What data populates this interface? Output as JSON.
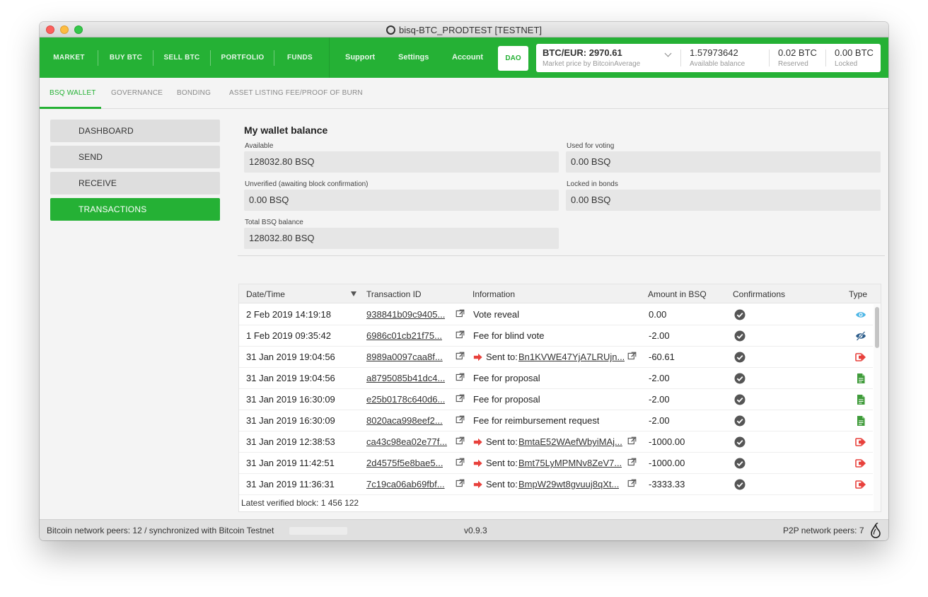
{
  "window": {
    "title": "bisq-BTC_PRODTEST [TESTNET]"
  },
  "topnav": {
    "left": [
      "MARKET",
      "BUY BTC",
      "SELL BTC",
      "PORTFOLIO",
      "FUNDS"
    ],
    "right": [
      "Support",
      "Settings",
      "Account"
    ],
    "dao": "DAO"
  },
  "balances": {
    "price_value": "BTC/EUR: 2970.61",
    "price_label": "Market price by BitcoinAverage",
    "available_value": "1.57973642",
    "available_label": "Available balance",
    "reserved_value": "0.02 BTC",
    "reserved_label": "Reserved",
    "locked_value": "0.00 BTC",
    "locked_label": "Locked"
  },
  "subtabs": [
    "BSQ WALLET",
    "GOVERNANCE",
    "BONDING",
    "ASSET LISTING FEE/PROOF OF BURN"
  ],
  "sidemenu": [
    "DASHBOARD",
    "SEND",
    "RECEIVE",
    "TRANSACTIONS"
  ],
  "wallet": {
    "title": "My wallet balance",
    "available_label": "Available",
    "available_value": "128032.80 BSQ",
    "voting_label": "Used for voting",
    "voting_value": "0.00 BSQ",
    "unverified_label": "Unverified (awaiting block confirmation)",
    "unverified_value": "0.00 BSQ",
    "bonds_label": "Locked in bonds",
    "bonds_value": "0.00 BSQ",
    "total_label": "Total BSQ balance",
    "total_value": "128032.80 BSQ"
  },
  "table": {
    "headers": [
      "Date/Time",
      "Transaction ID",
      "Information",
      "Amount in BSQ",
      "Confirmations",
      "Type"
    ],
    "rows": [
      {
        "date": "2 Feb 2019 14:19:18",
        "txid": "938841b09c9405...",
        "info": "Vote reveal",
        "sent_to": "",
        "amount": "0.00",
        "type": "eye-icon"
      },
      {
        "date": "1 Feb 2019 09:35:42",
        "txid": "6986c01cb21f75...",
        "info": "Fee for blind vote",
        "sent_to": "",
        "amount": "-2.00",
        "type": "eye-slash-icon"
      },
      {
        "date": "31 Jan 2019 19:04:56",
        "txid": "8989a0097caa8f...",
        "info": "Sent to:",
        "sent_to": "Bn1KVWE47YjA7LRUjn...",
        "amount": "-60.61",
        "type": "sent-icon"
      },
      {
        "date": "31 Jan 2019 19:04:56",
        "txid": "a8795085b41dc4...",
        "info": "Fee for proposal",
        "sent_to": "",
        "amount": "-2.00",
        "type": "document-icon"
      },
      {
        "date": "31 Jan 2019 16:30:09",
        "txid": "e25b0178c640d6...",
        "info": "Fee for proposal",
        "sent_to": "",
        "amount": "-2.00",
        "type": "document-icon"
      },
      {
        "date": "31 Jan 2019 16:30:09",
        "txid": "8020aca998eef2...",
        "info": "Fee for reimbursement request",
        "sent_to": "",
        "amount": "-2.00",
        "type": "document-icon"
      },
      {
        "date": "31 Jan 2019 12:38:53",
        "txid": "ca43c98ea02e77f...",
        "info": "Sent to:",
        "sent_to": "BmtaE52WAefWbyiMAj...",
        "amount": "-1000.00",
        "type": "sent-icon"
      },
      {
        "date": "31 Jan 2019 11:42:51",
        "txid": "2d4575f5e8bae5...",
        "info": "Sent to:",
        "sent_to": "Bmt75LyMPMNv8ZeV7...",
        "amount": "-1000.00",
        "type": "sent-icon"
      },
      {
        "date": "31 Jan 2019 11:36:31",
        "txid": "7c19ca06ab69fbf...",
        "info": "Sent to:",
        "sent_to": "BmpW29wt8gvuuj8qXt...",
        "amount": "-3333.33",
        "type": "sent-icon"
      }
    ]
  },
  "latest_block": "Latest verified block: 1 456 122",
  "status": {
    "left": "Bitcoin network peers: 12 / synchronized with Bitcoin Testnet",
    "version": "v0.9.3",
    "right": "P2P network peers: 7"
  },
  "colors": {
    "brand_green": "#25b135",
    "sent_red": "#e8413c",
    "doc_green": "#3f9b3a",
    "eye_blue": "#4db6e6"
  }
}
